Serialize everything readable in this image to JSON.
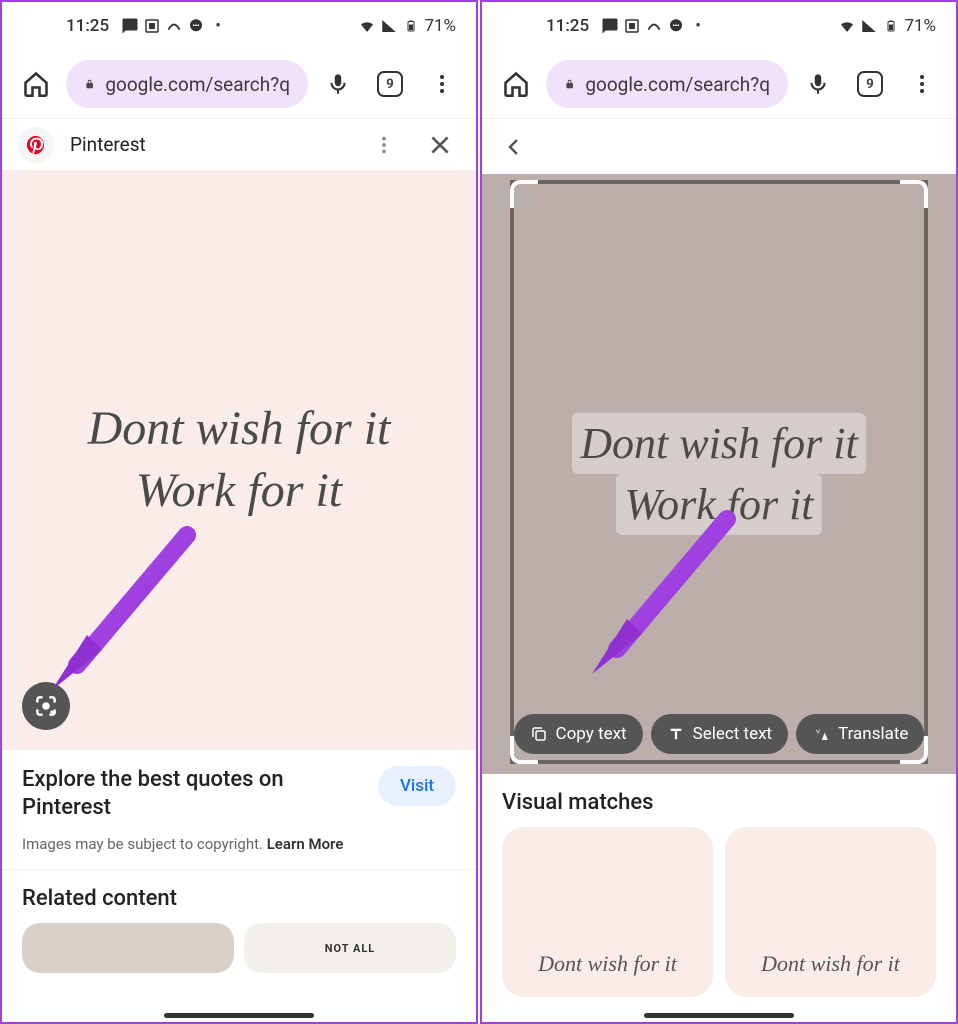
{
  "status": {
    "time": "11:25",
    "battery": "71%"
  },
  "browser": {
    "url": "google.com/search?q",
    "tab_count": "9"
  },
  "left": {
    "source_name": "Pinterest",
    "quote_line1": "Dont wish for it",
    "quote_line2": "Work for it",
    "info_title": "Explore the best quotes on Pinterest",
    "visit_label": "Visit",
    "copyright": "Images may be subject to copyright.",
    "learn_more": "Learn More",
    "related_title": "Related content",
    "related_card2_text": "NOT ALL"
  },
  "right": {
    "quote_line1": "Dont wish for it",
    "quote_line2": "Work for it",
    "chip_copy": "Copy text",
    "chip_select": "Select text",
    "chip_translate": "Translate",
    "visual_matches": "Visual matches",
    "vm_caption": "Dont wish for it"
  }
}
